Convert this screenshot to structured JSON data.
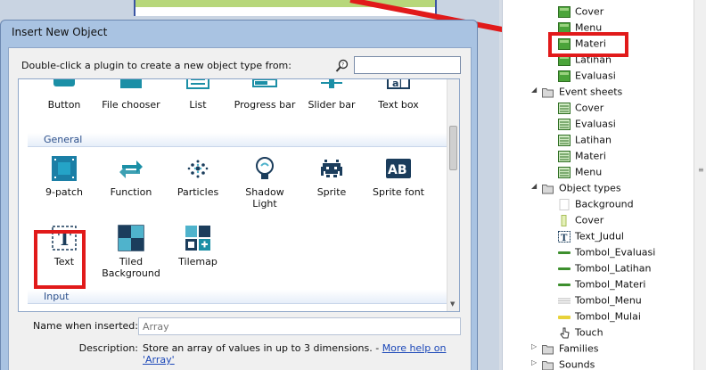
{
  "dialog": {
    "title": "Insert New Object",
    "prompt": "Double-click a plugin to create a new object type from:",
    "search_value": ""
  },
  "row_partial": [
    {
      "label": "Button",
      "icon": "button-icon"
    },
    {
      "label": "File chooser",
      "icon": "file-chooser-icon"
    },
    {
      "label": "List",
      "icon": "list-icon"
    },
    {
      "label": "Progress bar",
      "icon": "progress-bar-icon"
    },
    {
      "label": "Slider bar",
      "icon": "slider-bar-icon"
    },
    {
      "label": "Text box",
      "icon": "text-box-icon"
    }
  ],
  "groups": {
    "general": "General",
    "input": "Input"
  },
  "general_items": [
    {
      "label": "9-patch",
      "icon": "nine-patch-icon"
    },
    {
      "label": "Function",
      "icon": "function-icon"
    },
    {
      "label": "Particles",
      "icon": "particles-icon"
    },
    {
      "label": "Shadow Light",
      "icon": "shadow-light-icon"
    },
    {
      "label": "Sprite",
      "icon": "sprite-icon"
    },
    {
      "label": "Sprite font",
      "icon": "sprite-font-icon"
    },
    {
      "label": "Text",
      "icon": "text-icon"
    },
    {
      "label": "Tiled Background",
      "icon": "tiled-background-icon"
    },
    {
      "label": "Tilemap",
      "icon": "tilemap-icon"
    }
  ],
  "fields": {
    "name_label": "Name when inserted:",
    "name_placeholder": "Array",
    "description_label": "Description:",
    "description_text": "Store an array of values in up to 3 dimensions. - ",
    "help_link": "More help on 'Array'"
  },
  "tree": {
    "layouts": [
      "Cover",
      "Menu",
      "Materi",
      "Latihan",
      "Evaluasi"
    ],
    "event_sheets_label": "Event sheets",
    "event_sheets": [
      "Cover",
      "Evaluasi",
      "Latihan",
      "Materi",
      "Menu"
    ],
    "object_types_label": "Object types",
    "object_types": [
      "Background",
      "Cover",
      "Text_Judul",
      "Tombol_Evaluasi",
      "Tombol_Latihan",
      "Tombol_Materi",
      "Tombol_Menu",
      "Tombol_Mulai",
      "Touch"
    ],
    "families_label": "Families",
    "sounds_label": "Sounds"
  },
  "colors": {
    "highlight": "#e11a1a",
    "link": "#1b47b8",
    "group_header": "#2b4f8b"
  }
}
